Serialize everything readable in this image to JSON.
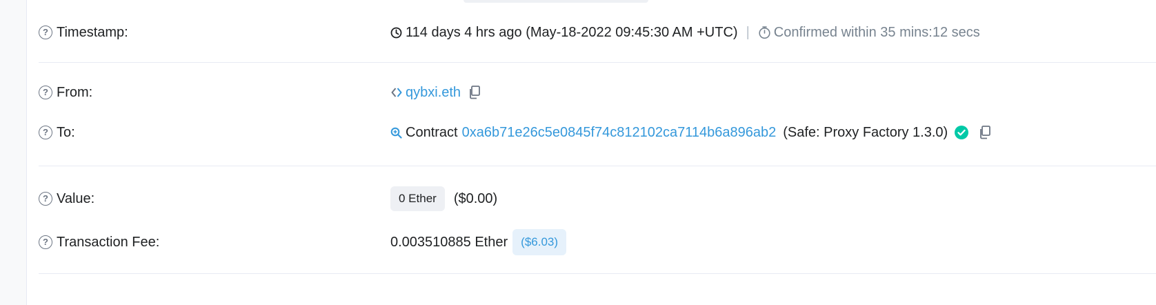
{
  "timestamp": {
    "label": "Timestamp:",
    "age": "114 days 4 hrs ago (May-18-2022 09:45:30 AM +UTC)",
    "separator": "|",
    "confirmed": "Confirmed within 35 mins:12 secs"
  },
  "from": {
    "label": "From:",
    "address": "qybxi.eth"
  },
  "to": {
    "label": "To:",
    "prefix": "Contract",
    "address": "0xa6b71e26c5e0845f74c812102ca7114b6a896ab2",
    "name": "(Safe: Proxy Factory 1.3.0)"
  },
  "value": {
    "label": "Value:",
    "amount": "0 Ether",
    "usd": "($0.00)"
  },
  "fee": {
    "label": "Transaction Fee:",
    "amount": "0.003510885 Ether",
    "usd": "($6.03)"
  },
  "colors": {
    "link": "#3498db",
    "verified": "#00c9a7",
    "muted": "#77838f"
  },
  "icons": {
    "help": "question-circle-icon",
    "clock": "clock-icon",
    "stopwatch": "stopwatch-icon",
    "ens": "ens-icon",
    "copy": "copy-icon",
    "contract": "contract-search-icon",
    "verified": "check-circle-icon"
  }
}
